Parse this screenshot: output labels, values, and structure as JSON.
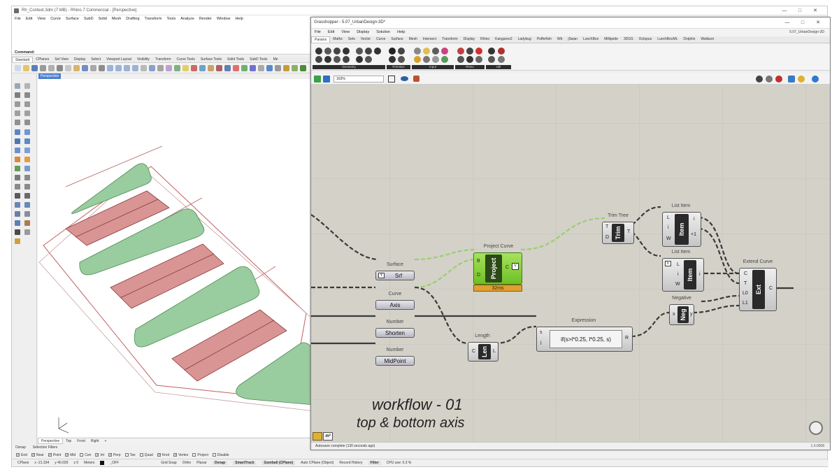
{
  "rhino": {
    "title": "Rh_Context.3dm (7 MB) - Rhino 7 Commercial - [Perspective]",
    "menu": [
      "File",
      "Edit",
      "View",
      "Curve",
      "Surface",
      "SubD",
      "Solid",
      "Mesh",
      "Drafting",
      "Transform",
      "Tools",
      "Analyze",
      "Render",
      "Window",
      "Help"
    ],
    "command_label": "Command:",
    "toolbar_tabs": [
      "Standard",
      "CPlanes",
      "Set View",
      "Display",
      "Select",
      "Viewport Layout",
      "Visibility",
      "Transform",
      "Curve Tools",
      "Surface Tools",
      "Solid Tools",
      "SubD Tools",
      "Me"
    ],
    "viewport_label": "Perspective",
    "viewport_tabs": [
      "Perspective",
      "Top",
      "Front",
      "Right",
      "+"
    ],
    "panel_tabs": [
      "Osnap",
      "Selection Filters"
    ],
    "osnaps": [
      {
        "label": "End",
        "checked": true
      },
      {
        "label": "Near",
        "checked": true
      },
      {
        "label": "Point",
        "checked": true
      },
      {
        "label": "Mid",
        "checked": true
      },
      {
        "label": "Cen",
        "checked": false
      },
      {
        "label": "Int",
        "checked": true
      },
      {
        "label": "Perp",
        "checked": true
      },
      {
        "label": "Tan",
        "checked": false
      },
      {
        "label": "Quad",
        "checked": false
      },
      {
        "label": "Knot",
        "checked": true
      },
      {
        "label": "Vertex",
        "checked": true
      },
      {
        "label": "Project",
        "checked": false
      },
      {
        "label": "Disable",
        "checked": false
      }
    ],
    "status": {
      "cplane": "CPlane",
      "x": "x -21.334",
      "y": "y 40.029",
      "z": "z 0",
      "units": "Meters",
      "layer": "_OFF",
      "items": [
        "Grid Snap",
        "Ortho",
        "Planar"
      ],
      "osnap": "Osnap",
      "smarttrack": "SmartTrack",
      "gumball": "Gumball (CPlane)",
      "autocplane": "Auto CPlane (Object)",
      "history": "Record History",
      "filter": "Filter",
      "cpu": "CPU use: 0.3 %"
    }
  },
  "gh": {
    "title": "Grasshopper - 5.07_UrbanDesign-3D*",
    "menu": [
      "File",
      "Edit",
      "View",
      "Display",
      "Solution",
      "Help"
    ],
    "doc_name": "5.07_UrbanDesign-3D",
    "tabs": [
      "Params",
      "Maths",
      "Sets",
      "Vector",
      "Curve",
      "Surface",
      "Mesh",
      "Intersect",
      "Transform",
      "Display",
      "Rhino",
      "Kangaroo2",
      "Ladybug",
      "Pufferfish",
      "Wb",
      "jSwan",
      "LunchBox",
      "Millipede",
      "3DGS",
      "Octopus",
      "LunchBoxML",
      "Dolphin",
      "Wallacei"
    ],
    "ribbon_groups": [
      "Geometry",
      "Primitive",
      "Input",
      "Rhino",
      "Util"
    ],
    "zoom": "163%",
    "status_message": "Autosave complete (130 seconds ago)",
    "version": "1.0.0008",
    "nodes": {
      "surface": {
        "label": "Surface",
        "text": "Srf"
      },
      "curve": {
        "label": "Curve",
        "text": "Axis"
      },
      "number1": {
        "label": "Number",
        "text": "Shorten"
      },
      "number2": {
        "label": "Number",
        "text": "MidPoint"
      },
      "project": {
        "label": "Project Curve",
        "core": "Project",
        "inputs": [
          "B",
          "D"
        ],
        "output": "C",
        "time": "32ms"
      },
      "trim": {
        "label": "Trim Tree",
        "core": "Trim",
        "inputs": [
          "T",
          "D"
        ],
        "output": "T"
      },
      "list1": {
        "label": "List Item",
        "core": "Item",
        "inputs": [
          "L",
          "i",
          "W"
        ],
        "outputs": [
          "i",
          "+1"
        ]
      },
      "list2": {
        "label": "List Item",
        "core": "Item",
        "inputs": [
          "L",
          "i",
          "W"
        ],
        "output": "i"
      },
      "length": {
        "label": "Length",
        "core": "Len",
        "input": "C",
        "output": "L"
      },
      "expression": {
        "label": "Expression",
        "inputs": [
          "s",
          "l"
        ],
        "expr": "if(s>l*0.25, l*0.25, s)",
        "output": "R"
      },
      "negative": {
        "label": "Negative",
        "core": "Neg",
        "input": "x",
        "output": "y"
      },
      "extend": {
        "label": "Extend Curve",
        "core": "Ext",
        "inputs": [
          "C",
          "T",
          "L0",
          "L1"
        ],
        "output": "C"
      }
    }
  },
  "caption": {
    "line1": "workflow - 01",
    "line2": "top & bottom axis"
  },
  "colors": {
    "green_fill": "#99cc9e",
    "red_fill": "#d99494",
    "gh_canvas": "#d4d1c9",
    "component_green": "#7fcf2f",
    "time_orange": "#e0a030",
    "wire_dark": "#3a3a3a",
    "wire_selected": "#98d070"
  }
}
